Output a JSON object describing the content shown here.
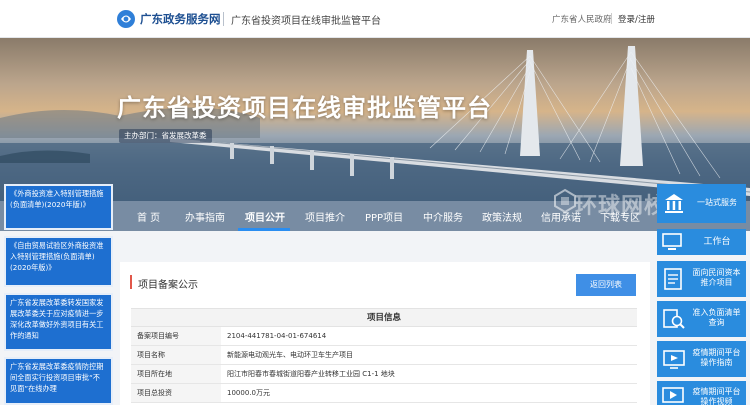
{
  "header": {
    "site_name": "广东政务服务网",
    "platform_name": "广东省投资项目在线审批监管平台",
    "gov_link": "广东省人民政府",
    "login": "登录/注册"
  },
  "banner": {
    "title": "广东省投资项目在线审批监管平台",
    "subtitle": "主办部门：省发展改革委"
  },
  "nav": {
    "items": [
      "首 页",
      "办事指南",
      "项目公开",
      "项目推介",
      "PPP项目",
      "中介服务",
      "政策法规",
      "信用承诺",
      "下载专区"
    ],
    "active_index": 2
  },
  "notices": [
    "《外商投资准入特别管理措施(负面清单)(2020年版)》",
    "《自由贸易试验区外商投资准入特别管理措施(负面清单)(2020年版)》",
    "广东省发展改革委转发国家发展改革委关于应对疫情进一步深化改革做好外资项目有关工作的通知",
    "广东省发展改革委疫情防控期间全面实行投资项目审批“不见面”在线办理"
  ],
  "panel": {
    "title": "项目备案公示",
    "back_button": "返回列表",
    "table_title": "项目信息",
    "rows": [
      {
        "label": "备案项目编号",
        "value": "2104-441781-04-01-674614"
      },
      {
        "label": "项目名称",
        "value": "新能源电动观光车、电动环卫车生产项目"
      },
      {
        "label": "项目所在地",
        "value": "阳江市阳春市春城街道阳春产业转移工业园 C1-1 地块"
      },
      {
        "label": "项目总投资",
        "value": "10000.0万元"
      }
    ]
  },
  "sidebar": {
    "tiles": [
      {
        "id": "onestop",
        "label": "一站式服务",
        "icon": "building-icon"
      },
      {
        "id": "work",
        "label": "工作台",
        "icon": "monitor-icon"
      },
      {
        "id": "neg",
        "label": "面向民间资本推介项目",
        "icon": "document-icon"
      },
      {
        "id": "entry",
        "label": "准入负面清单查询",
        "icon": "search-doc-icon"
      },
      {
        "id": "epidemic",
        "label": "疫情期间平台操作指南",
        "icon": "guide-icon"
      },
      {
        "id": "epidemic2",
        "label": "疫情期间平台操作视频",
        "icon": "video-icon"
      }
    ]
  },
  "watermark": "环球网校",
  "colors": {
    "brand_blue": "#1e6fd0",
    "tile_blue": "#2a8cde",
    "button_blue": "#3f8fe6",
    "accent_red": "#e1574a"
  }
}
